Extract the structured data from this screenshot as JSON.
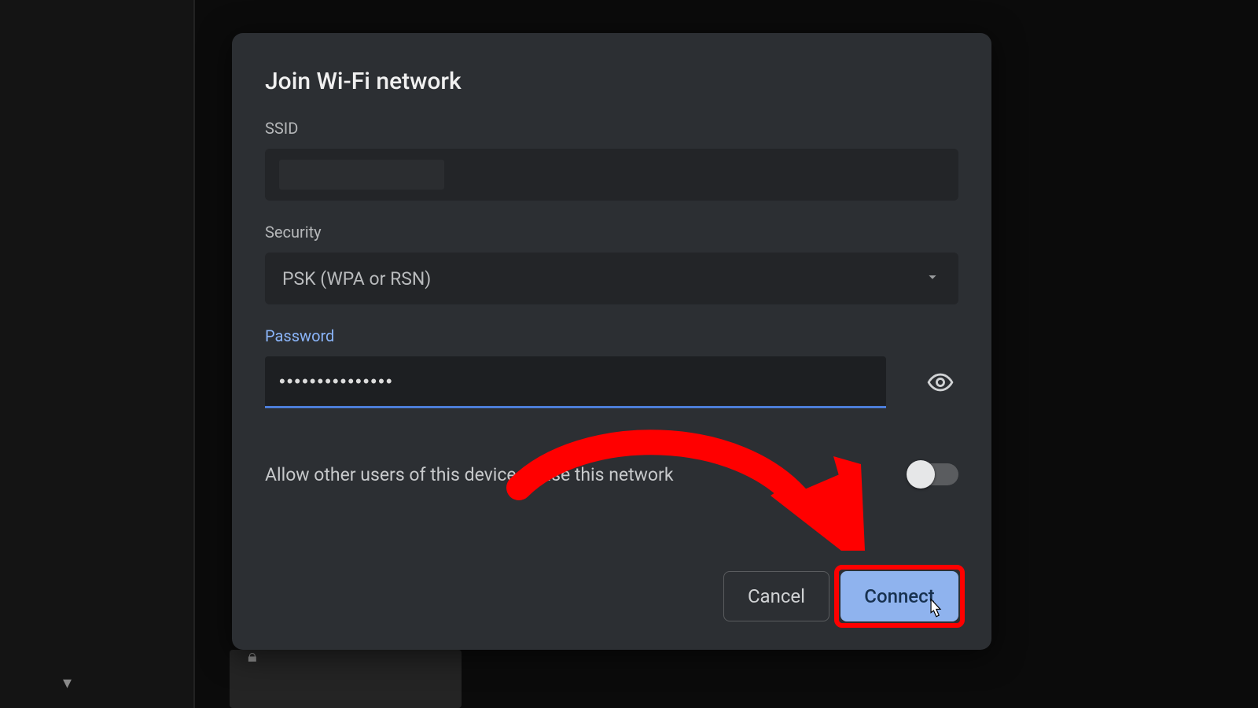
{
  "dialog": {
    "title": "Join Wi-Fi network",
    "ssid_label": "SSID",
    "ssid_value": "",
    "security_label": "Security",
    "security_value": "PSK (WPA or RSN)",
    "password_label": "Password",
    "password_value": "•••••••••••••••",
    "share_label": "Allow other users of this device to use this network",
    "share_enabled": false,
    "cancel_label": "Cancel",
    "connect_label": "Connect"
  },
  "colors": {
    "accent": "#8ab4f8",
    "focus_underline": "#4c7dd8",
    "highlight": "#ff0000"
  }
}
